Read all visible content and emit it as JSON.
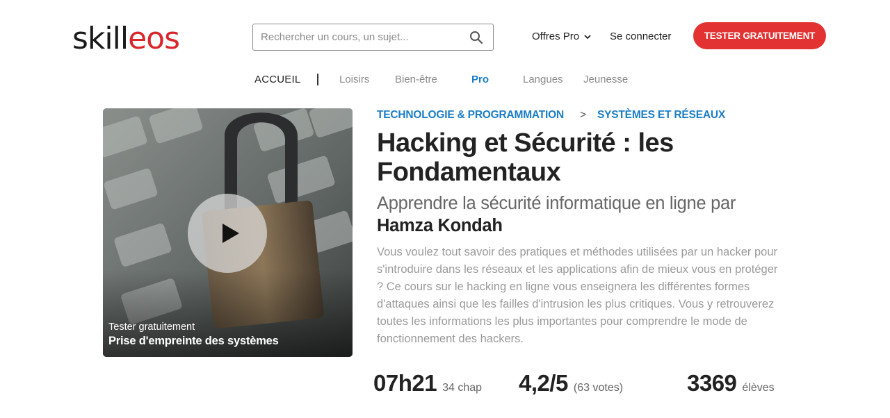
{
  "header": {
    "logo_part1": "skill",
    "logo_part2": "eos",
    "search_placeholder": "Rechercher un cours, un sujet...",
    "search_icon": "search-icon",
    "offres_label": "Offres Pro",
    "offres_icon": "chevron-down-icon",
    "connect_label": "Se connecter",
    "cta_label": "TESTER GRATUITEMENT",
    "colors": {
      "brand_red": "#e23232",
      "accent_blue": "#1a7dc6"
    }
  },
  "nav": {
    "home": "ACCUEIL",
    "items": [
      "Loisirs",
      "Bien-être",
      "Pro",
      "Langues",
      "Jeunesse"
    ],
    "active": "Pro"
  },
  "video": {
    "play_icon": "play-icon",
    "caption_small": "Tester gratuitement",
    "caption_bold": "Prise d'empreinte des systèmes"
  },
  "course": {
    "breadcrumb": [
      "TECHNOLOGIE & PROGRAMMATION",
      "SYSTÈMES ET RÉSEAUX"
    ],
    "breadcrumb_sep": ">",
    "title": "Hacking et Sécurité : les Fondamentaux",
    "subtitle": "Apprendre la sécurité informatique en ligne par",
    "author": "Hamza Kondah",
    "description": "Vous voulez tout savoir des pratiques et méthodes utilisées par un hacker pour s'introduire dans les réseaux et les applications afin de mieux vous en protéger ? Ce cours sur le hacking en ligne vous enseignera les différentes formes d'attaques ainsi que les failles d'intrusion les plus critiques. Vous y retrouverez toutes les informations les plus importantes pour comprendre le mode de fonctionnement des hackers."
  },
  "stats": {
    "duration": "07h21",
    "chapters": "34 chap",
    "rating": "4,2/5",
    "votes": "(63 votes)",
    "students": "3369",
    "students_label": "élèves"
  }
}
